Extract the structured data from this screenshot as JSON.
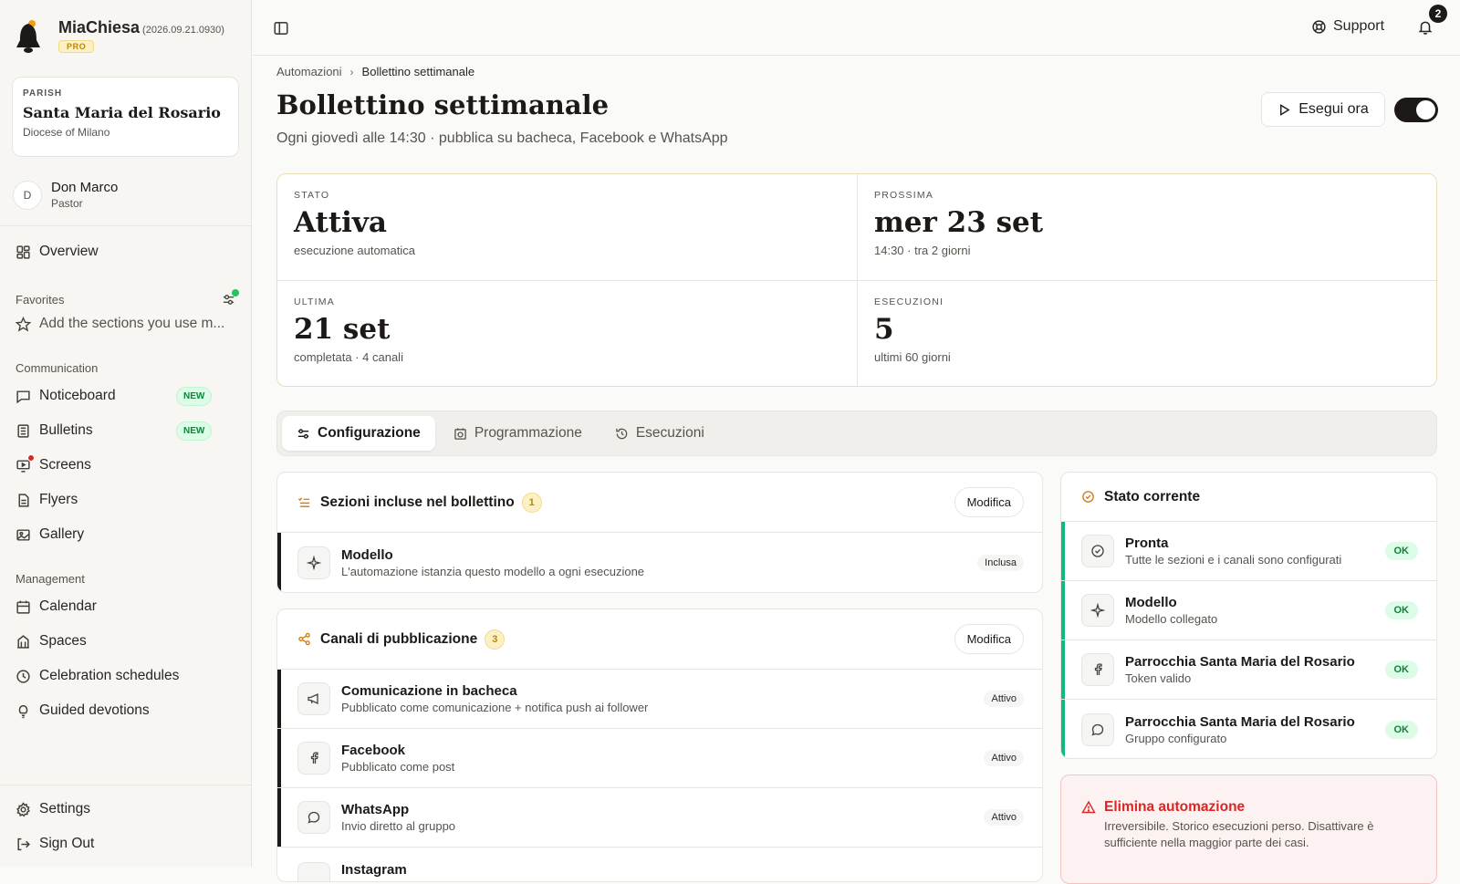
{
  "app": {
    "name": "MiaChiesa",
    "version": "(2026.09.21.0930)",
    "plan": "PRO"
  },
  "parish": {
    "kicker": "PARISH",
    "name": "Santa Maria del Rosario",
    "diocese": "Diocese of Milano"
  },
  "user": {
    "initial": "D",
    "name": "Don Marco",
    "role": "Pastor"
  },
  "sidebar": {
    "overview": "Overview",
    "favorites": {
      "label": "Favorites",
      "hint": "Add the sections you use m..."
    },
    "communication": {
      "label": "Communication",
      "items": [
        {
          "label": "Noticeboard",
          "badge": "NEW"
        },
        {
          "label": "Bulletins",
          "badge": "NEW"
        },
        {
          "label": "Screens"
        },
        {
          "label": "Flyers"
        },
        {
          "label": "Gallery"
        }
      ]
    },
    "management": {
      "label": "Management",
      "items": [
        {
          "label": "Calendar"
        },
        {
          "label": "Spaces"
        },
        {
          "label": "Celebration schedules"
        },
        {
          "label": "Guided devotions"
        }
      ]
    },
    "footer": {
      "settings": "Settings",
      "sign_out": "Sign Out"
    }
  },
  "topbar": {
    "support": "Support",
    "notifications": "2"
  },
  "breadcrumb": {
    "parent": "Automazioni",
    "current": "Bollettino settimanale"
  },
  "page": {
    "title": "Bollettino settimanale",
    "subtitle": "Ogni giovedì alle 14:30 · pubblica su bacheca, Facebook e WhatsApp",
    "run_now": "Esegui ora",
    "enabled": true
  },
  "stats": [
    {
      "key": "STATO",
      "value": "Attiva",
      "sub": "esecuzione automatica"
    },
    {
      "key": "PROSSIMA",
      "value": "mer 23 set",
      "sub": "14:30 · tra 2 giorni"
    },
    {
      "key": "ULTIMA",
      "value": "21 set",
      "sub": "completata · 4 canali"
    },
    {
      "key": "ESECUZIONI",
      "value": "5",
      "sub": "ultimi 60 giorni"
    }
  ],
  "tabs": [
    {
      "label": "Configurazione",
      "active": true
    },
    {
      "label": "Programmazione"
    },
    {
      "label": "Esecuzioni"
    }
  ],
  "sections_card": {
    "title": "Sezioni incluse nel bollettino",
    "count": "1",
    "edit": "Modifica",
    "rows": [
      {
        "title": "Modello",
        "sub": "L'automazione istanzia questo modello a ogni esecuzione",
        "status": "Inclusa",
        "icon": "sparkle-icon"
      }
    ]
  },
  "channels_card": {
    "title": "Canali di pubblicazione",
    "count": "3",
    "edit": "Modifica",
    "rows": [
      {
        "title": "Comunicazione in bacheca",
        "sub": "Pubblicato come comunicazione + notifica push ai follower",
        "status": "Attivo",
        "icon": "megaphone-icon"
      },
      {
        "title": "Facebook",
        "sub": "Pubblicato come post",
        "status": "Attivo",
        "icon": "facebook-icon"
      },
      {
        "title": "WhatsApp",
        "sub": "Invio diretto al gruppo",
        "status": "Attivo",
        "icon": "chat-icon"
      },
      {
        "title": "Instagram"
      }
    ]
  },
  "status_card": {
    "title": "Stato corrente",
    "rows": [
      {
        "title": "Pronta",
        "sub": "Tutte le sezioni e i canali sono configurati",
        "status": "OK",
        "icon": "check-circle-icon"
      },
      {
        "title": "Modello",
        "sub": "Modello collegato",
        "status": "OK",
        "icon": "sparkle-icon"
      },
      {
        "title": "Parrocchia Santa Maria del Rosario",
        "sub": "Token valido",
        "status": "OK",
        "icon": "facebook-icon"
      },
      {
        "title": "Parrocchia Santa Maria del Rosario",
        "sub": "Gruppo configurato",
        "status": "OK",
        "icon": "chat-icon"
      }
    ]
  },
  "danger": {
    "title": "Elimina automazione",
    "text": "Irreversibile. Storico esecuzioni perso. Disattivare è sufficiente nella maggior parte dei casi."
  }
}
